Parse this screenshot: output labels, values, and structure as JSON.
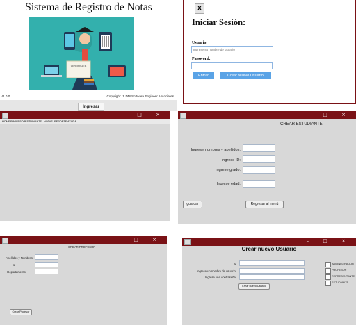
{
  "colors": {
    "titlebar": "#7a1216",
    "panel": "#d8d8d8",
    "button_blue": "#5aa3e6",
    "bottom_strip": "#e6e6e6"
  },
  "splash": {
    "title": "Sistema de Registro de Notas",
    "version": "V1.0.0",
    "copyright": "Copyright: JLDM Software Engineer Associates",
    "ingresar": "Ingresar",
    "certificate_text": "CERTIFICATE"
  },
  "login": {
    "close_glyph": "X",
    "title": "Iniciar Sesión:",
    "usuario_label": "Usuario:",
    "usuario_placeholder": "Ingrese su nombre de usuario",
    "password_label": "Password:",
    "entrar": "Entrar",
    "crear": "Crear Nuevo Usuario"
  },
  "window_controls": "– □ ×",
  "main_menu": {
    "items": [
      "HOME",
      "PROFESOR",
      "ESTUDIANTE",
      "NOTAS",
      "REPORTE",
      "AYUDA"
    ]
  },
  "crear_estudiante": {
    "title": "CREAR ESTUDIANTE",
    "nombres": "Ingrese nombres y apellidos:",
    "id": "Ingrese ID:",
    "grado": "Ingrese grado:",
    "edad": "Ingrese edad:",
    "guardar": "guardar",
    "regresar": "Regresar al menú"
  },
  "crear_profesor": {
    "title": "CREAR PROFESOR",
    "apellidos": "Apellidos y Nombres:",
    "id": "Id",
    "departamento": "Departamento:",
    "button": "Crear Profesor"
  },
  "crear_usuario": {
    "title": "Crear nuevo Usuario",
    "id": "Id",
    "usuario": "Ingrese un nombre de usuario:",
    "contrasena": "Ingrese una contraseña:",
    "button": "Crear nuevo Usuario",
    "roles": [
      "ADMINISTRADOR",
      "PROFESOR",
      "REPRESENTANTE",
      "ESTUDIANTE"
    ]
  }
}
